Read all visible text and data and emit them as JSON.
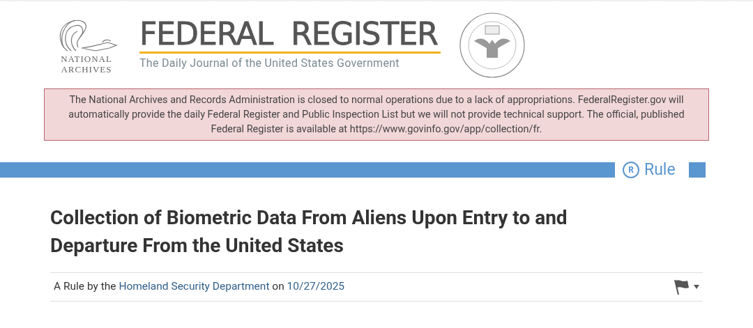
{
  "header": {
    "archives_logo": {
      "line_1": "NATIONAL",
      "line_2": "ARCHIVES"
    },
    "title": "FEDERAL  REGISTER",
    "subtitle": "The Daily Journal of the United States Government"
  },
  "alert": {
    "text": "The National Archives and Records Administration is closed to normal operations due to a lack of appropriations. FederalRegister.gov will automatically provide the daily Federal Register and Public Inspection List but we will not provide technical support. The official, published Federal Register is available at https://www.govinfo.gov/app/collection/fr."
  },
  "document_type": {
    "letter": "R",
    "label": "Rule"
  },
  "document": {
    "title": "Collection of Biometric Data From Aliens Upon Entry to and Departure From the United States",
    "byline": {
      "prefix": "A Rule by the",
      "agency": "Homeland Security Department",
      "joiner": "on",
      "date": "10/27/2025"
    }
  }
}
